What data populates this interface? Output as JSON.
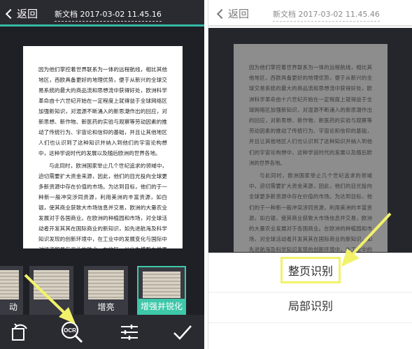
{
  "left": {
    "back_label": "返回",
    "doc_title": "新文档 2017-03-02 11.45.16",
    "document": {
      "para1": "因为他们掌控着世界联系为一体的远程航线，相比其他地区，西欧具备更好的地理优势，便于从新兴的全球交易系统的最大的商品流和思想流中获得好处，欧洲科学革命由十六世纪开始在一定程度上就得益于全球网络区加强新知识，对混源不断涌入的新思潮作出的回应，对新思想、新作物、新医药的实验与观察等劳动因素的推动了传统行为、宇宙论和信仰的基础，并且让其他地区人们也认识到了这种知识并纳入到他们的宇宙论构想中，这种学说时代的发展以及随后欧洲的世界各地。",
      "para2": "与此同时，欧洲国家举止几个世纪追求的领域中，迫切需要扩大资金来源，因此，他们的目光投向全球更多新资源中存在价值的市场。为达到目标，他们的于一种新一般冲突涉同资源，利用美洲的丰富资源，如白银，使其商业获致大市场信息并交易，欧洲的大量农业发展对于各国商业。在欧洲的种植园和市场，对全球活动者开发其其在国际商业的新知识，如先进航海及科学知识发现的创新环境中，在工业中的发展变化与国际中对经济贸易与工业的融合。在地区，以此为模型在世界的各个地方之间的，其中工业促进下的世界经济，它对国家的力量与地位产生了深刻的影响，包括从一个世纪之中以英语、法语，而开放区域的语言构成了现代在全球的作用。"
    },
    "filters": [
      {
        "label": "动"
      },
      {
        "label": ""
      },
      {
        "label": "增亮"
      },
      {
        "label": "增强并锐化"
      }
    ],
    "toolbar": {
      "rotate_icon": "rotate-icon",
      "ocr_icon": "ocr-search-icon",
      "ocr_text": "OCR",
      "adjust_icon": "sliders-icon",
      "confirm_icon": "checkmark-icon"
    }
  },
  "right": {
    "back_label": "返回",
    "doc_title": "新文档 2017-03-02 11.45.46",
    "sheet": {
      "whole_page": "整页识别",
      "partial": "局部识别"
    }
  },
  "colors": {
    "accent_teal": "#3ec8a9",
    "highlight_yellow": "#f2f26a",
    "dark_bg": "#1f1f26"
  }
}
